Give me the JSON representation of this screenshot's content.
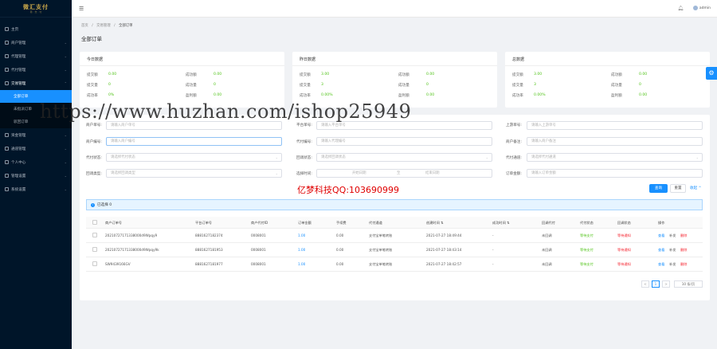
{
  "app": {
    "logo": "微汇支付",
    "logo_sub": "易 · 支 · 付"
  },
  "sidebar": {
    "items": [
      {
        "label": "主页"
      },
      {
        "label": "商户管理"
      },
      {
        "label": "代理管理"
      },
      {
        "label": "代付管理"
      },
      {
        "label": "交易管理"
      },
      {
        "label": "资金管理"
      },
      {
        "label": "通道管理"
      },
      {
        "label": "个人中心"
      },
      {
        "label": "管理设置"
      },
      {
        "label": "系统设置"
      }
    ],
    "subitems": [
      {
        "label": "全部订单"
      },
      {
        "label": "未指派订单"
      },
      {
        "label": "驳回订单"
      }
    ]
  },
  "topbar": {
    "user": "admin"
  },
  "breadcrumb": {
    "home": "首页",
    "sep": "/",
    "section": "交易管理",
    "current": "全部订单"
  },
  "page": {
    "title": "全部订单"
  },
  "stats": [
    {
      "title": "今日数据",
      "rows": [
        {
          "k1": "提交额",
          "v1": "0.00",
          "k2": "成功额",
          "v2": "0.00"
        },
        {
          "k1": "提交量",
          "v1": "0",
          "k2": "成功量",
          "v2": "0"
        },
        {
          "k1": "成功率",
          "v1": "0%",
          "k2": "盈利额",
          "v2": "0.00"
        }
      ]
    },
    {
      "title": "昨日数据",
      "rows": [
        {
          "k1": "提交额",
          "v1": "3.00",
          "k2": "成功额",
          "v2": "0.00"
        },
        {
          "k1": "提交量",
          "v1": "3",
          "k2": "成功量",
          "v2": "0"
        },
        {
          "k1": "成功率",
          "v1": "0.00%",
          "k2": "盈利额",
          "v2": "0.00"
        }
      ]
    },
    {
      "title": "总数据",
      "rows": [
        {
          "k1": "提交额",
          "v1": "3.00",
          "k2": "成功额",
          "v2": "0.00"
        },
        {
          "k1": "提交量",
          "v1": "3",
          "k2": "成功量",
          "v2": "0"
        },
        {
          "k1": "成功率",
          "v1": "0.00%",
          "k2": "盈利额",
          "v2": "0.00"
        }
      ]
    }
  ],
  "filters": {
    "merchant_order": {
      "label": "商户单号:",
      "placeholder": "请输入商户单号"
    },
    "platform_order": {
      "label": "平台单号:",
      "placeholder": "请输入平台单号"
    },
    "upstream_order": {
      "label": "上游单号:",
      "placeholder": "请输入上游单号"
    },
    "merchant_no": {
      "label": "商户编号:",
      "placeholder": "请输入商户编号"
    },
    "agent_no": {
      "label": "代付编号:",
      "placeholder": "请输入代理编号"
    },
    "merchant_note": {
      "label": "商户备注:",
      "placeholder": "请输入商户备注"
    },
    "payout_status": {
      "label": "代付状态:",
      "placeholder": "请选择代付状态"
    },
    "callback_status": {
      "label": "回调状态:",
      "placeholder": "请选择回调状态"
    },
    "payout_channel": {
      "label": "代付通道:",
      "placeholder": "请选择代付通道"
    },
    "callback_type": {
      "label": "回调类型:",
      "placeholder": "请选择回调类型"
    },
    "time": {
      "label": "选择时间:",
      "start": "开始日期",
      "to": "至",
      "end": "结束日期"
    },
    "amount": {
      "label": "订单金额:",
      "placeholder": "请输入订单金额"
    }
  },
  "watermark": "https://www.huzhan.com/ishop25949",
  "promo": "亿梦科技QQ:103690999",
  "actions": {
    "search": "查询",
    "reset": "重置",
    "collapse": "收起 ^"
  },
  "selection": {
    "text": "已选择 0"
  },
  "table": {
    "headers": [
      "商户订单号",
      "平台订单号",
      "商户代付ID",
      "订单金额",
      "手续费",
      "代付通道",
      "创建时间 ⇅",
      "成功时间 ⇅",
      "回调代付",
      "代付状态",
      "回调状态",
      "操作"
    ],
    "rows": [
      {
        "cells": [
          "20210727171338000d9Wpqy9",
          "8881627182374",
          "0008001",
          "1.00",
          "0.00",
          "支付宝单笔转账",
          "2021-07-27 18:49:44",
          "-",
          "未回调",
          "等待支付",
          "等待通知"
        ],
        "ops": [
          "查看",
          "补发",
          "删除"
        ]
      },
      {
        "cells": [
          "20210727171338000d9Wpqy9k",
          "8881627181953",
          "0008001",
          "1.00",
          "0.00",
          "支付宝单笔转账",
          "2021-07-27 18:43:14",
          "-",
          "未回调",
          "等待支付",
          "等待通知"
        ],
        "ops": [
          "查看",
          "补发",
          "删除"
        ]
      },
      {
        "cells": [
          "SW9439166GV",
          "8881627181977",
          "0008001",
          "1.00",
          "0.00",
          "支付宝单笔转账",
          "2021-07-27 18:42:57",
          "-",
          "未回调",
          "等待支付",
          "等待通知"
        ],
        "ops": [
          "查看",
          "补发",
          "删除"
        ]
      }
    ]
  },
  "pagination": {
    "prev": "<",
    "page": "1",
    "next": ">",
    "size": "10 条/页"
  },
  "colors": {
    "primary": "#1890ff",
    "sidebar": "#001529",
    "success": "#52c41a",
    "danger": "#f5222d"
  }
}
